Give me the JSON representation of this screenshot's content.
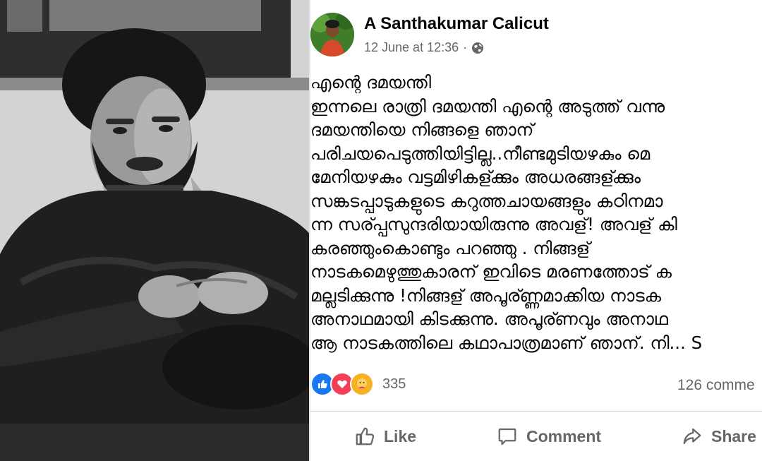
{
  "photo": {
    "subject": "author-portrait"
  },
  "post": {
    "author": "A Santhakumar Calicut",
    "date": "12 June at 12:36",
    "separator": "·",
    "privacy_icon": "globe-icon",
    "lines": [
      "എന്റെ ദമയന്തി",
      "ഇന്നലെ രാത്രി ദമയന്തി എന്റെ അടുത്ത് വന്നു",
      "ദമയന്തിയെ നിങ്ങളെ ഞാന്",
      "പരിചയപെടുത്തിയിട്ടില്ല..നീണ്ടമുടിയഴകും മെ",
      "മേനിയഴകും വട്ടമിഴികള്ക്കും അധരങ്ങള്ക്കും",
      "സങ്കടപ്പാടുകളുടെ കറുത്തചായങ്ങളും കഠിനമാ",
      "ന്ന സര്പ്പസുന്ദരിയായിരുന്നു അവള്! അവള് കി",
      "കരഞ്ഞുംകൊണ്ടും പറഞ്ഞു . നിങ്ങള്",
      "നാടകമെഴുത്തുകാരന് ഇവിടെ മരണത്തോട് ക",
      "മല്ലടിക്കുന്നു !നിങ്ങള് അപൂര്ണ്ണമാക്കിയ നാടക",
      "അനാഥമായി കിടക്കുന്നു. അപൂര്ണവും അനാഥ",
      "ആ നാടകത്തിലെ കഥാപാത്രമാണ് ഞാന്. നി... S"
    ],
    "reactions": {
      "icons": [
        "like-icon",
        "love-icon",
        "care-icon"
      ],
      "count": "335"
    },
    "comments": "126 comme",
    "actions": {
      "like": "Like",
      "comment": "Comment",
      "share": "Share"
    },
    "colors": {
      "like_blue": "#1877f2",
      "love_red": "#f33e58",
      "care_yellow": "#f7b125",
      "secondary_text": "#65676b"
    }
  }
}
